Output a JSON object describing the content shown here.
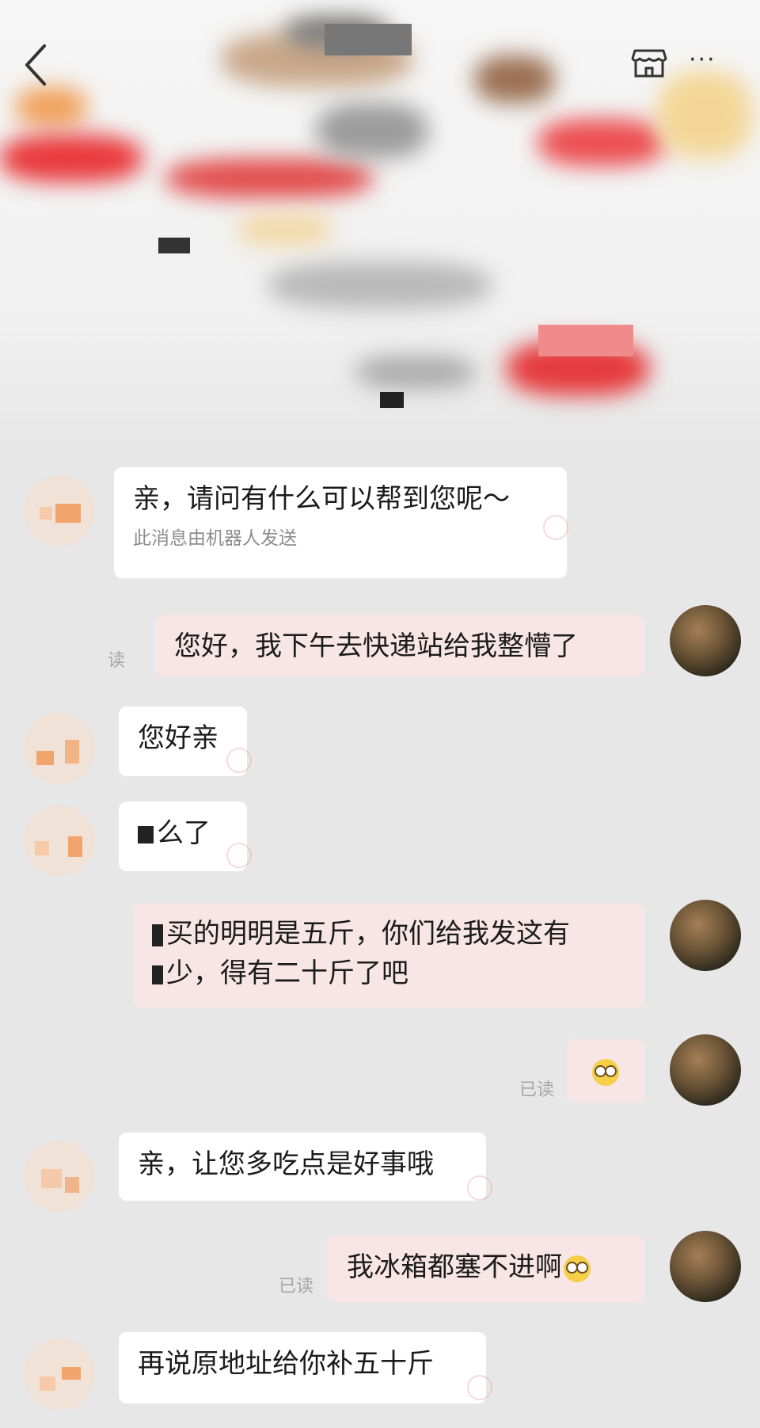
{
  "topbar": {
    "back_icon": "chevron-left-icon",
    "shop_icon": "storefront-icon",
    "more_label": "···"
  },
  "messages": [
    {
      "side": "left",
      "text": "亲，请问有什么可以帮到您呢～",
      "sub": "此消息由机器人发送"
    },
    {
      "side": "right",
      "text": "您好，我下午去快递站给我整懵了",
      "read": "读"
    },
    {
      "side": "left",
      "text": "您好亲"
    },
    {
      "side": "left",
      "text": "么了"
    },
    {
      "side": "right",
      "line1": "买的明明是五斤，你们给我发这有",
      "line2": "少，得有二十斤了吧"
    },
    {
      "side": "right",
      "emoji": "thinking-face-icon",
      "read": "已读"
    },
    {
      "side": "left",
      "text": "亲，让您多吃点是好事哦"
    },
    {
      "side": "right",
      "text": "我冰箱都塞不进啊",
      "emoji": "flushed-face-icon",
      "read": "已读"
    },
    {
      "side": "left",
      "text": "再说原地址给你补五十斤"
    }
  ]
}
